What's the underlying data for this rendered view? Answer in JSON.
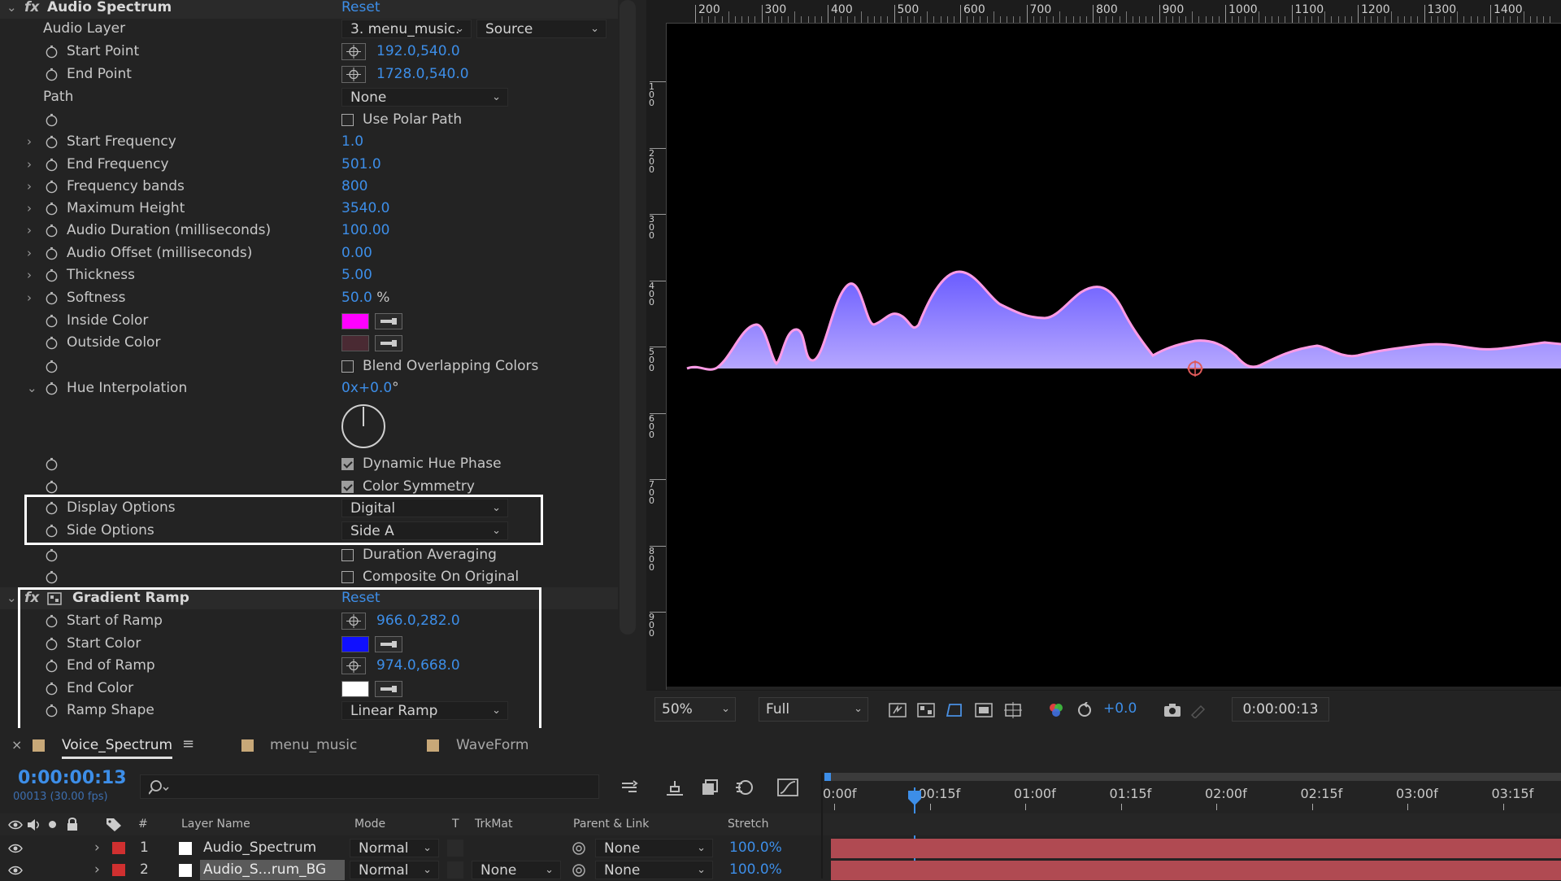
{
  "effect_controls": {
    "audio_spectrum": {
      "fx_label": "fx",
      "title": "Audio Spectrum",
      "reset": "Reset",
      "audio_layer_label": "Audio Layer",
      "audio_layer_value": "3. menu_music.",
      "audio_layer_source": "Source",
      "start_point_label": "Start Point",
      "start_point_value": "192.0,540.0",
      "end_point_label": "End Point",
      "end_point_value": "1728.0,540.0",
      "path_label": "Path",
      "path_value": "None",
      "use_polar_path": "Use Polar Path",
      "start_frequency_label": "Start Frequency",
      "start_frequency_value": "1.0",
      "end_frequency_label": "End Frequency",
      "end_frequency_value": "501.0",
      "frequency_bands_label": "Frequency bands",
      "frequency_bands_value": "800",
      "maximum_height_label": "Maximum Height",
      "maximum_height_value": "3540.0",
      "audio_duration_label": "Audio Duration (milliseconds)",
      "audio_duration_value": "100.00",
      "audio_offset_label": "Audio Offset (milliseconds)",
      "audio_offset_value": "0.00",
      "thickness_label": "Thickness",
      "thickness_value": "5.00",
      "softness_label": "Softness",
      "softness_value": "50.0",
      "softness_unit": "%",
      "inside_color_label": "Inside Color",
      "inside_color": "#ff00ff",
      "outside_color_label": "Outside Color",
      "outside_color": "#4a2a33",
      "blend_overlapping": "Blend Overlapping Colors",
      "hue_interpolation_label": "Hue Interpolation",
      "hue_interpolation_value": "0x+0.0",
      "hue_interpolation_unit": "°",
      "dynamic_hue_phase": "Dynamic Hue Phase",
      "color_symmetry": "Color Symmetry",
      "display_options_label": "Display Options",
      "display_options_value": "Digital",
      "side_options_label": "Side Options",
      "side_options_value": "Side A",
      "duration_averaging": "Duration Averaging",
      "composite_on_original": "Composite On Original"
    },
    "gradient_ramp": {
      "fx_label": "fx",
      "title": "Gradient Ramp",
      "reset": "Reset",
      "start_of_ramp_label": "Start of Ramp",
      "start_of_ramp_value": "966.0,282.0",
      "start_color_label": "Start Color",
      "start_color": "#1010ff",
      "end_of_ramp_label": "End of Ramp",
      "end_of_ramp_value": "974.0,668.0",
      "end_color_label": "End Color",
      "end_color": "#ffffff",
      "ramp_shape_label": "Ramp Shape",
      "ramp_shape_value": "Linear Ramp"
    }
  },
  "viewer": {
    "ruler_top": [
      "200",
      "300",
      "400",
      "500",
      "600",
      "700",
      "800",
      "900",
      "1000",
      "1100",
      "1200",
      "1300",
      "1400"
    ],
    "ruler_left": [
      "100",
      "200",
      "300",
      "400",
      "500",
      "600",
      "700",
      "800",
      "900"
    ],
    "zoom": "50%",
    "resolution": "Full",
    "exposure": "+0.0",
    "timecode": "0:00:00:13",
    "waveform_fill_top": "#6a5cff",
    "waveform_fill_bottom": "#b7a8ff",
    "waveform_stroke": "#ff9be6"
  },
  "timeline": {
    "tabs": [
      {
        "label": "Voice_Spectrum",
        "color": "#c8a878"
      },
      {
        "label": "menu_music",
        "color": "#c8a878"
      },
      {
        "label": "WaveForm",
        "color": "#c8a878"
      }
    ],
    "current_time": "0:00:00:13",
    "frame_info": "00013 (30.00 fps)",
    "time_markers": [
      "0:00f",
      "00:15f",
      "01:00f",
      "01:15f",
      "02:00f",
      "02:15f",
      "03:00f",
      "03:15f"
    ],
    "columns": {
      "number": "#",
      "layer_name": "Layer Name",
      "mode": "Mode",
      "t": "T",
      "trkmat": "TrkMat",
      "parent": "Parent & Link",
      "stretch": "Stretch"
    },
    "layers": [
      {
        "num": "1",
        "name": "Audio_Spectrum",
        "mode": "Normal",
        "trkmat": "",
        "parent": "None",
        "stretch": "100.0%"
      },
      {
        "num": "2",
        "name": "Audio_S...rum_BG",
        "mode": "Normal",
        "trkmat": "None",
        "parent": "None",
        "stretch": "100.0%"
      }
    ]
  }
}
